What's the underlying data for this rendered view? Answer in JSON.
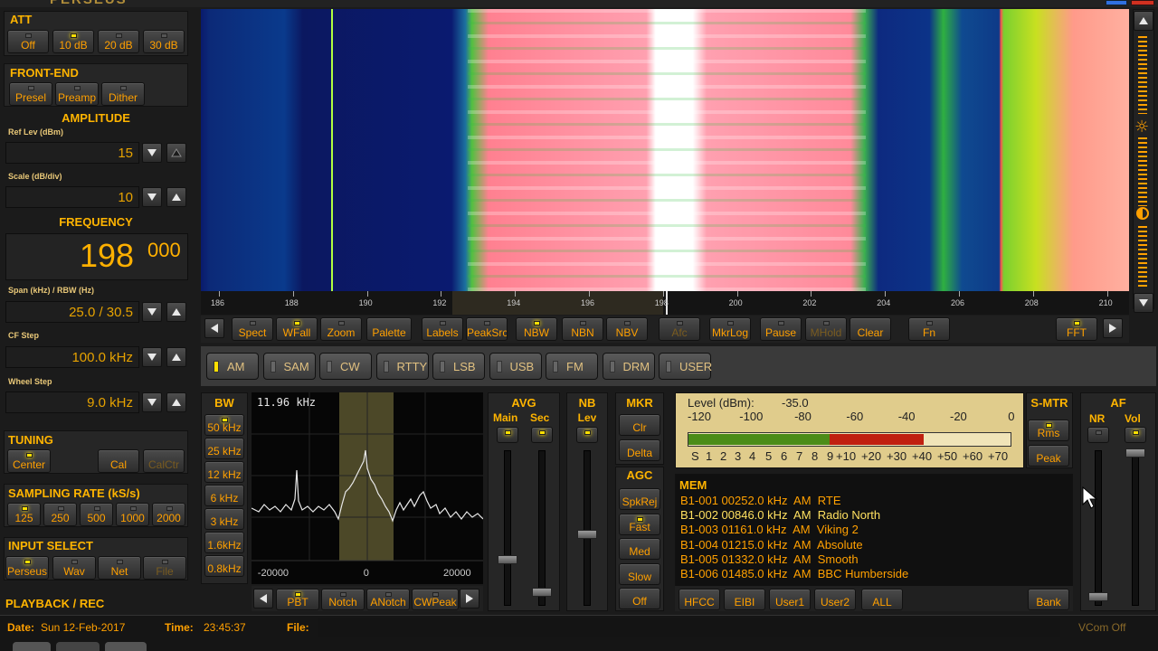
{
  "app": {
    "title": "PERSEUS"
  },
  "att": {
    "title": "ATT",
    "buttons": [
      "Off",
      "10 dB",
      "20 dB",
      "30 dB"
    ],
    "active_index": 1
  },
  "frontend": {
    "title": "FRONT-END",
    "buttons": [
      "Presel",
      "Preamp",
      "Dither"
    ]
  },
  "amplitude": {
    "title": "AMPLITUDE",
    "ref_label": "Ref Lev (dBm)",
    "ref_value": "15",
    "scale_label": "Scale (dB/div)",
    "scale_value": "10"
  },
  "frequency": {
    "title": "FREQUENCY",
    "main": "198",
    "sub": "000",
    "span_label": "Span (kHz) / RBW (Hz)",
    "span_value": "25.0 / 30.5",
    "cf_label": "CF Step",
    "cf_value": "100.0 kHz",
    "wheel_label": "Wheel Step",
    "wheel_value": "9.0 kHz"
  },
  "tuning": {
    "title": "TUNING",
    "buttons": [
      "Center",
      "Cal",
      "CalCtr"
    ]
  },
  "sampling": {
    "title": "SAMPLING RATE (kS/s)",
    "buttons": [
      "125",
      "250",
      "500",
      "1000",
      "2000"
    ],
    "active_index": 0
  },
  "input": {
    "title": "INPUT SELECT",
    "buttons": [
      "Perseus",
      "Wav",
      "Net",
      "File"
    ],
    "active_index": 0
  },
  "playback": {
    "title": "PLAYBACK / REC"
  },
  "status": {
    "date_label": "Date:",
    "date": "Sun 12-Feb-2017",
    "time_label": "Time:",
    "time": "23:45:37",
    "file_label": "File:",
    "vcom": "VCom Off"
  },
  "spectrum_axis": {
    "ticks": [
      "186",
      "188",
      "190",
      "192",
      "194",
      "196",
      "198",
      "200",
      "202",
      "204",
      "206",
      "208",
      "210"
    ]
  },
  "toolbar": {
    "buttons": [
      "Spect",
      "WFall",
      "Zoom",
      "Palette",
      "Labels",
      "PeakSrc",
      "NBW",
      "NBN",
      "NBV",
      "Afc",
      "MkrLog",
      "Pause",
      "MHold",
      "Clear",
      "Fn",
      "FFT"
    ]
  },
  "modes": {
    "buttons": [
      "AM",
      "SAM",
      "CW",
      "RTTY",
      "LSB",
      "USB",
      "FM",
      "DRM",
      "USER"
    ],
    "active_index": 0
  },
  "bw": {
    "title": "BW",
    "buttons": [
      "50 kHz",
      "25 kHz",
      "12 kHz",
      "6 kHz",
      "3 kHz",
      "1.6kHz",
      "0.8kHz"
    ],
    "active_index": 0
  },
  "filter": {
    "bw_value": "11.96 kHz",
    "ticks": [
      "-20000",
      "0",
      "20000"
    ],
    "buttons": [
      "PBT",
      "Notch",
      "ANotch",
      "CWPeak"
    ]
  },
  "avg": {
    "title": "AVG",
    "main": "Main",
    "sec": "Sec"
  },
  "nb": {
    "title": "NB",
    "lev": "Lev"
  },
  "mkr": {
    "title": "MKR",
    "buttons": [
      "Clr",
      "Delta"
    ]
  },
  "agc": {
    "title": "AGC",
    "buttons": [
      "SpkRej",
      "Fast",
      "Med",
      "Slow",
      "Off"
    ],
    "active_index": 1
  },
  "level": {
    "label": "Level (dBm):",
    "value": "-35.0",
    "ticks": [
      "-120",
      "-100",
      "-80",
      "-60",
      "-40",
      "-20",
      "0"
    ],
    "s_scale": [
      "S",
      "1",
      "2",
      "3",
      "4",
      "5",
      "6",
      "7",
      "8",
      "9",
      "+10",
      "+20",
      "+30",
      "+40",
      "+50",
      "+60",
      "+70"
    ],
    "fill_fraction": 0.85
  },
  "smtr": {
    "title": "S-MTR",
    "buttons": [
      "Rms",
      "Peak"
    ]
  },
  "af": {
    "title": "AF",
    "nr": "NR",
    "vol": "Vol"
  },
  "mem": {
    "title": "MEM",
    "rows": [
      "B1-001 00252.0 kHz  AM  RTE",
      "B1-002 00846.0 kHz  AM  Radio North",
      "B1-003 01161.0 kHz  AM  Viking 2",
      "B1-004 01215.0 kHz  AM  Absolute",
      "B1-005 01332.0 kHz  AM  Smooth",
      "B1-006 01485.0 kHz  AM  BBC Humberside"
    ],
    "selected_index": 1,
    "buttons": [
      "HFCC",
      "EIBI",
      "User1",
      "User2",
      "ALL",
      "Bank"
    ]
  },
  "colors": {
    "accent": "#ffa000",
    "led": "#ffe000",
    "meter_green": "#4c8c18",
    "meter_red": "#c02010"
  }
}
